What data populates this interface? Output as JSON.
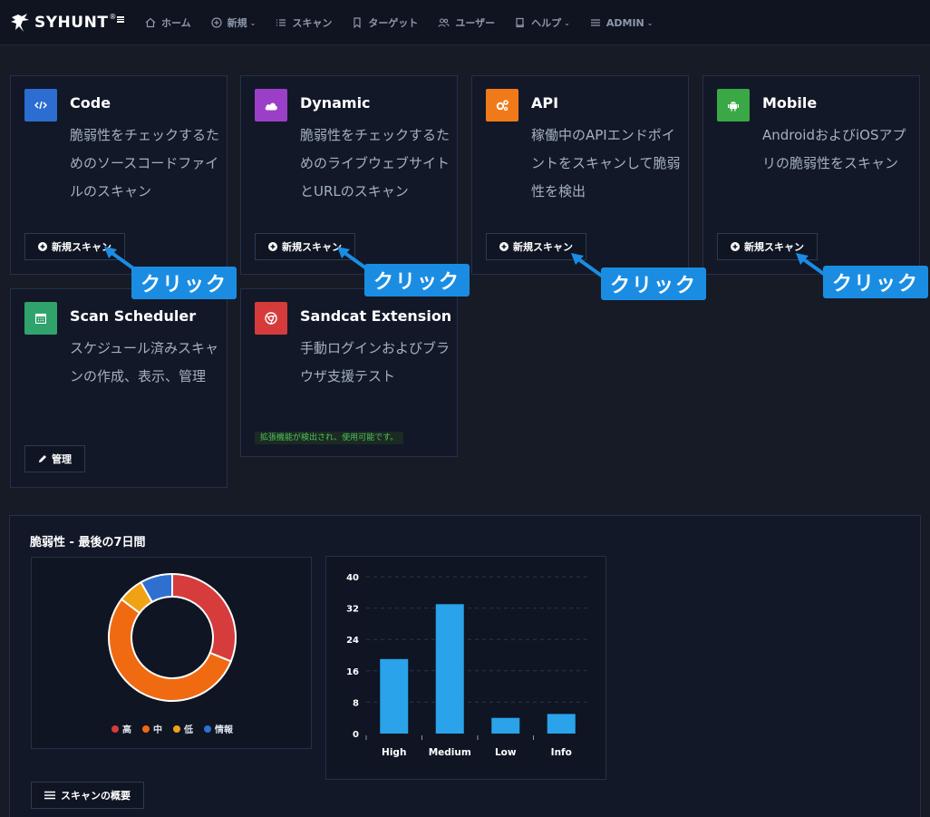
{
  "app": {
    "logo_text": "SYHUNT",
    "logo_sup": "®"
  },
  "nav": {
    "items": [
      {
        "label": "ホーム",
        "icon": "home-icon",
        "caret": false
      },
      {
        "label": "新規",
        "icon": "plus-circle-icon",
        "caret": true
      },
      {
        "label": "スキャン",
        "icon": "list-icon",
        "caret": false
      },
      {
        "label": "ターゲット",
        "icon": "bookmark-icon",
        "caret": false
      },
      {
        "label": "ユーザー",
        "icon": "users-icon",
        "caret": false
      },
      {
        "label": "ヘルプ",
        "icon": "book-icon",
        "caret": true
      },
      {
        "label": "ADMIN",
        "icon": "menu-icon",
        "caret": true
      }
    ],
    "caret_glyph": "⌄"
  },
  "cards": {
    "code": {
      "title": "Code",
      "desc": "脆弱性をチェックするためのソースコードファイルのスキャン",
      "button": "新規スキャン",
      "color": "#2b6dd1",
      "icon": "code-icon"
    },
    "dynamic": {
      "title": "Dynamic",
      "desc": "脆弱性をチェックするためのライブウェブサイトとURLのスキャン",
      "button": "新規スキャン",
      "color": "#9b3fc9",
      "icon": "cloud-icon"
    },
    "api": {
      "title": "API",
      "desc": "稼働中のAPIエンドポイントをスキャンして脆弱性を検出",
      "button": "新規スキャン",
      "color": "#f07a1a",
      "icon": "gears-icon"
    },
    "mobile": {
      "title": "Mobile",
      "desc": "AndroidおよびiOSアプリの脆弱性をスキャン",
      "button": "新規スキャン",
      "color": "#3aa845",
      "icon": "android-icon"
    },
    "scheduler": {
      "title": "Scan Scheduler",
      "desc": "スケジュール済みスキャンの作成、表示、管理",
      "button": "管理",
      "color": "#2fa36b",
      "icon": "calendar-icon"
    },
    "sandcat": {
      "title": "Sandcat Extension",
      "desc": "手動ログインおよびブラウザ支援テスト",
      "note": "拡張機能が検出され、使用可能です。",
      "color": "#d63b3b",
      "icon": "chrome-icon"
    }
  },
  "annotations": {
    "click_label": "クリック"
  },
  "vuln_panel": {
    "title": "脆弱性 - 最後の7日間",
    "summary_button": "スキャンの概要",
    "legend": [
      {
        "label": "高",
        "color": "#d63c3c"
      },
      {
        "label": "中",
        "color": "#f06a12"
      },
      {
        "label": "低",
        "color": "#f0a215"
      },
      {
        "label": "情報",
        "color": "#2f6fd0"
      }
    ]
  },
  "chart_data": [
    {
      "type": "pie",
      "donut": true,
      "categories": [
        "高",
        "中",
        "低",
        "情報"
      ],
      "values": [
        19,
        33,
        4,
        5
      ],
      "colors": [
        "#d63c3c",
        "#f06a12",
        "#f0a215",
        "#2f6fd0"
      ]
    },
    {
      "type": "bar",
      "categories": [
        "High",
        "Medium",
        "Low",
        "Info"
      ],
      "values": [
        19,
        33,
        4,
        5
      ],
      "ylim": [
        0,
        40
      ],
      "yticks": [
        0,
        8,
        16,
        24,
        32,
        40
      ],
      "color": "#2aa3ea",
      "grid": true
    }
  ]
}
